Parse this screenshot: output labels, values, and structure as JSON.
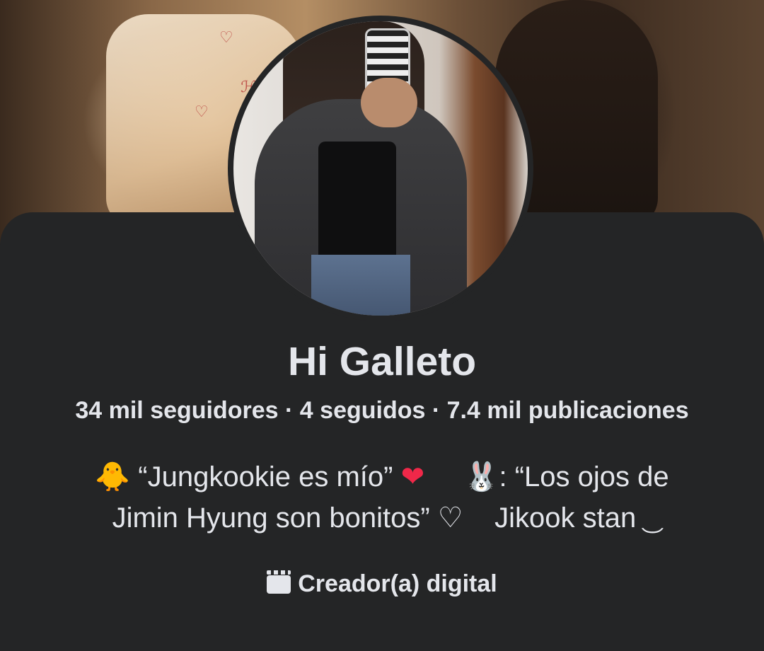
{
  "profile": {
    "name": "Hi Galleto",
    "stats": "34 mil seguidores · 4 seguidos · 7.4 mil publicaciones",
    "bio": {
      "line1_a": "🐥 “Jungkookie es mío” ",
      "line1_heart": "❤",
      "line1_b": "     🐰: “Los ojos de",
      "line2": "Jimin Hyung son bonitos” ♡    Jikook stan ͜ "
    },
    "category": "Creador(a) digital"
  },
  "colors": {
    "background": "#242526",
    "text": "#e4e6eb",
    "heart": "#f02849"
  },
  "icons": {
    "category_icon": "clapperboard-icon"
  }
}
